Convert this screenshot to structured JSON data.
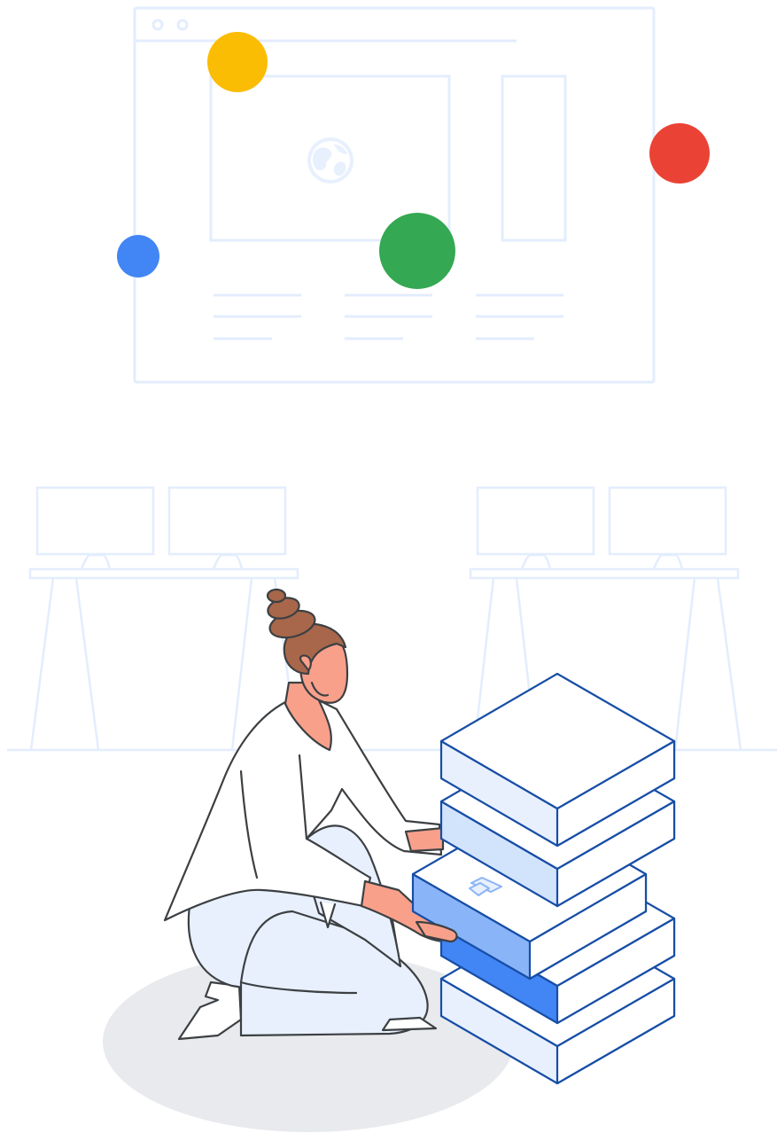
{
  "illustration": {
    "subject": "person-stacking-boxes",
    "icons": [
      "globe-icon",
      "box-logo-icon"
    ],
    "colors": {
      "wireframe": "#E8F0FE",
      "wireframe_stroke": "#E3EDFD",
      "yellow": "#FBBC04",
      "red": "#EA4335",
      "green": "#34A853",
      "blue": "#4285F4",
      "box_outline": "#174EA6",
      "box_light": "#E8F0FE",
      "box_mid": "#D2E3FC",
      "box_accent": "#8AB4F8",
      "box_strong": "#4285F4",
      "skin": "#F9A08B",
      "hair": "#A8674A",
      "shirt": "#FFFFFF",
      "pants": "#E8F0FE",
      "shadow": "#E8EAED",
      "line": "#3C4043"
    }
  }
}
